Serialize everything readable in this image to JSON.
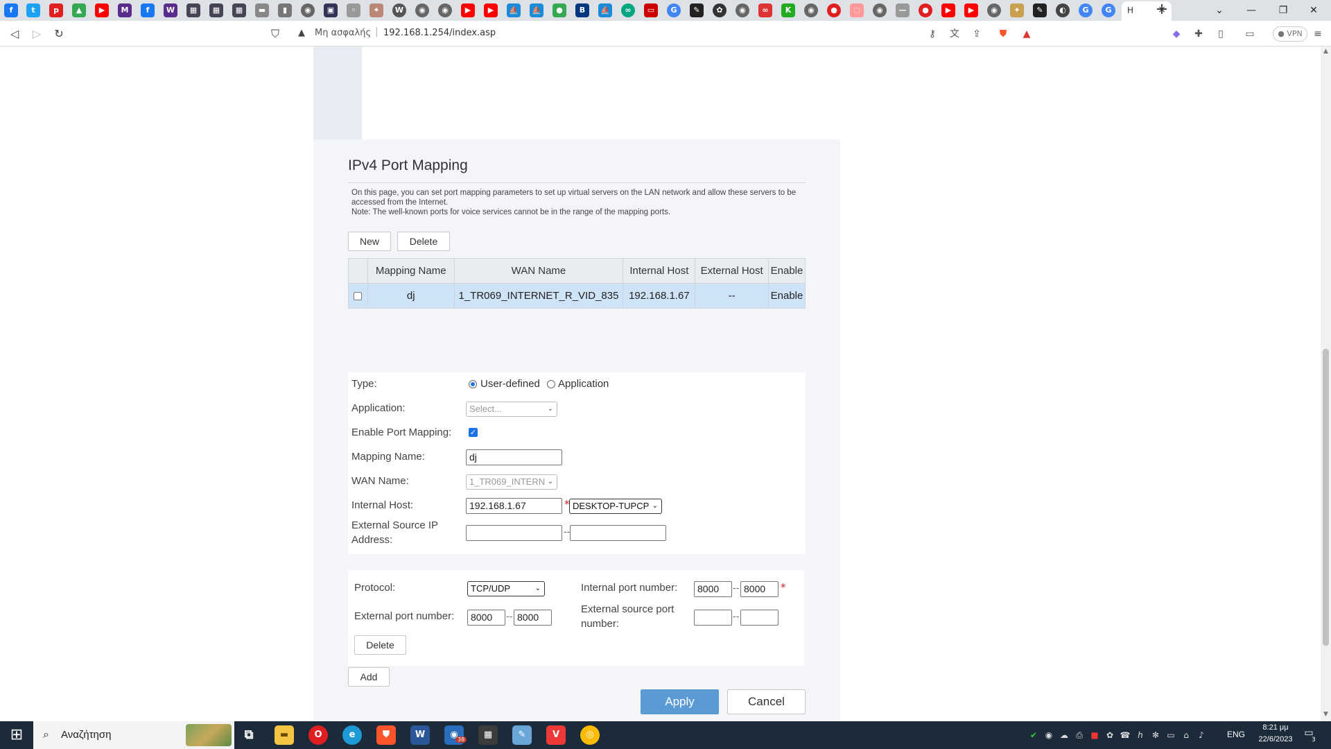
{
  "browser": {
    "active_tab_title": "H",
    "close_glyph": "×",
    "new_tab_glyph": "+",
    "url_warning": "Μη ασφαλής",
    "url": "192.168.1.254/index.asp",
    "vpn_label": "VPN"
  },
  "page": {
    "title": "IPv4 Port Mapping",
    "description_1": "On this page, you can set port mapping parameters to set up virtual servers on the LAN network and allow these servers to be accessed from the Internet.",
    "description_2": "Note: The well-known ports for voice services cannot be in the range of the mapping ports.",
    "new_label": "New",
    "delete_label": "Delete"
  },
  "table": {
    "headers": [
      "",
      "Mapping Name",
      "WAN Name",
      "Internal Host",
      "External Host",
      "Enable"
    ],
    "rows": [
      {
        "mapping_name": "dj",
        "wan_name": "1_TR069_INTERNET_R_VID_835",
        "internal_host": "192.168.1.67",
        "external_host": "--",
        "enable": "Enable"
      }
    ]
  },
  "form": {
    "type_label": "Type:",
    "type_option_user": "User-defined",
    "type_option_app": "Application",
    "type_selected": "User-defined",
    "application_label": "Application:",
    "application_value": "Select...",
    "enable_label": "Enable Port Mapping:",
    "enable_checked": true,
    "mapping_name_label": "Mapping Name:",
    "mapping_name_value": "dj",
    "wan_name_label": "WAN Name:",
    "wan_name_value": "1_TR069_INTERN",
    "internal_host_label": "Internal Host:",
    "internal_host_value": "192.168.1.67",
    "internal_host_device": "DESKTOP-TUPCP",
    "ext_src_ip_label_1": "External Source IP",
    "ext_src_ip_label_2": "Address:",
    "ext_src_ip_start": "",
    "ext_src_ip_end": ""
  },
  "ports": {
    "protocol_label": "Protocol:",
    "protocol_value": "TCP/UDP",
    "internal_port_label": "Internal port number:",
    "internal_port_start": "8000",
    "internal_port_end": "8000",
    "external_port_label": "External port number:",
    "external_port_start": "8000",
    "external_port_end": "8000",
    "ext_src_port_label_1": "External source port",
    "ext_src_port_label_2": "number:",
    "ext_src_port_start": "",
    "ext_src_port_end": "",
    "delete_label": "Delete",
    "add_label": "Add"
  },
  "actions": {
    "apply_label": "Apply",
    "cancel_label": "Cancel"
  },
  "taskbar": {
    "search_text": "Αναζήτηση",
    "language": "ENG",
    "time": "8:21 μμ",
    "date": "22/6/2023",
    "outlook_badge": "38",
    "notification_count": "3"
  },
  "colors": {
    "apply_button": "#5b9bd5",
    "selected_row": "#cfe3f7",
    "required_mark": "#e02020",
    "taskbar": "#1c2b3a"
  }
}
